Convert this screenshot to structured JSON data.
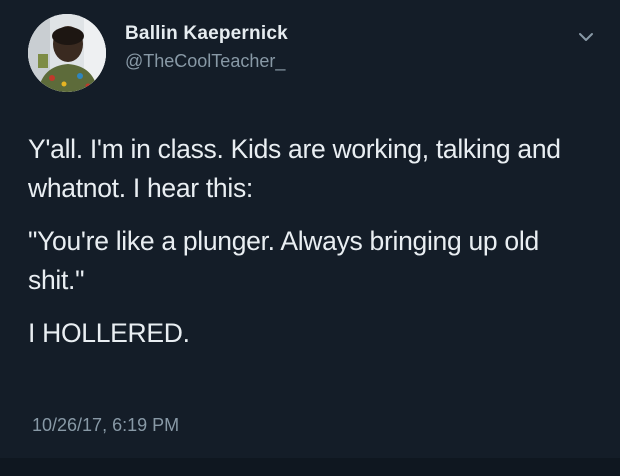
{
  "tweet": {
    "author": {
      "display_name": "Ballin Kaepernick",
      "handle": "@TheCoolTeacher_",
      "avatar_icon": "profile-photo"
    },
    "menu_icon": "chevron-down-icon",
    "paragraphs": [
      "Y'all. I'm in class. Kids are working, talking and whatnot. I hear this:",
      "\"You're like a plunger. Always bringing up old shit.\"",
      "I HOLLERED."
    ],
    "timestamp": "10/26/17, 6:19 PM"
  },
  "colors": {
    "background": "#141d28",
    "primary_text": "#e9eef2",
    "secondary_text": "#8899a6"
  }
}
